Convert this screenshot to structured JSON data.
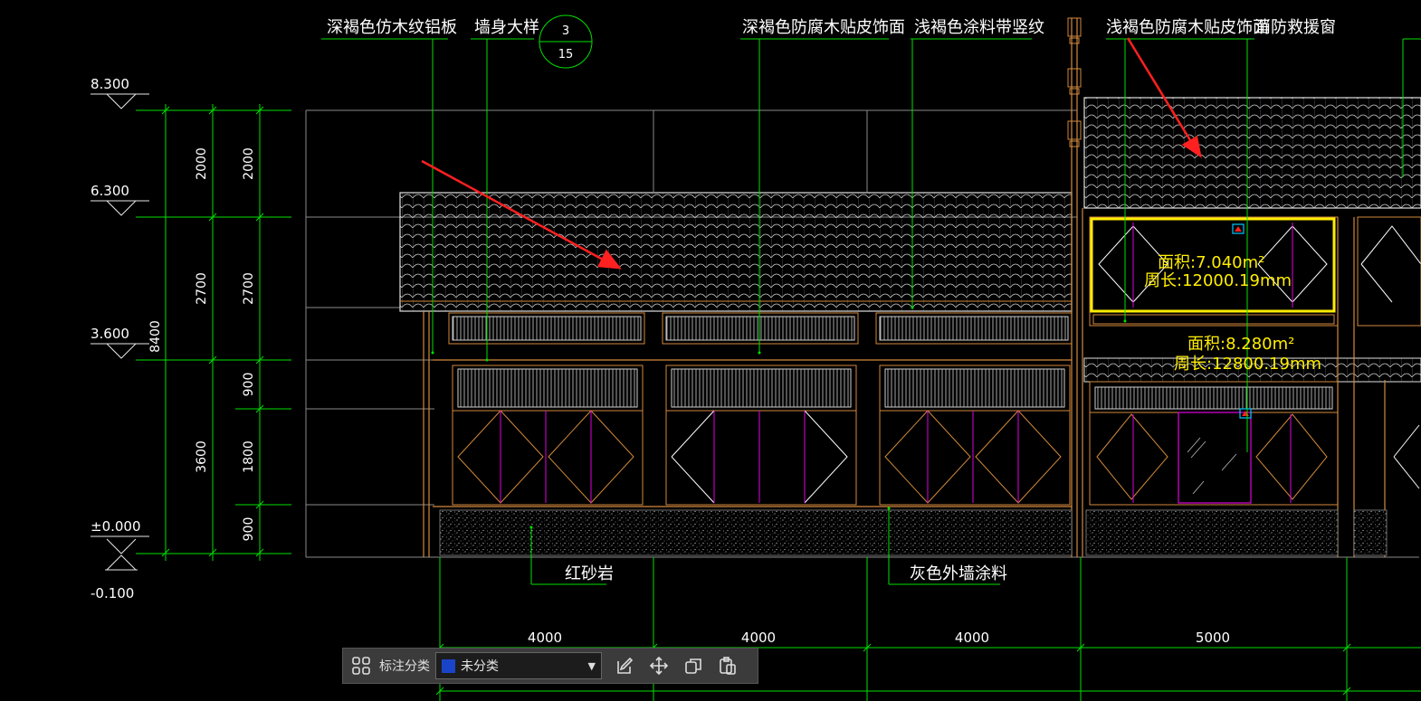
{
  "colors": {
    "background": "#000000",
    "grid": "#00e000",
    "outline": "#d8d8d8",
    "wood": "#d2893c",
    "magenta": "#e000e0",
    "highlight": "#ffee00",
    "arrow": "#ff2020",
    "label": "#ffffff",
    "toolbar_bg": "#3b3b3b",
    "swatch": "#1a44c8"
  },
  "elevations": [
    {
      "label": "8.300"
    },
    {
      "label": "6.300"
    },
    {
      "label": "3.600"
    },
    {
      "label": "±0.000"
    },
    {
      "label": "-0.100"
    }
  ],
  "total_height_label": "8400",
  "dims_col1": [
    "2000",
    "2700",
    "3600"
  ],
  "dims_col2": [
    "2000",
    "2700",
    "900",
    "1800",
    "900"
  ],
  "callouts": {
    "aluminum": "深褐色仿木纹铝板",
    "wall_detail": "墙身大样",
    "detail_top": "3",
    "detail_bottom": "15",
    "dark_wood": "深褐色防腐木贴皮饰面",
    "light_paint": "浅褐色涂料带竖纹",
    "light_wood": "浅褐色防腐木贴皮饰面",
    "fire_window": "消防救援窗",
    "red_sandstone": "红砂岩",
    "grey_paint": "灰色外墙涂料"
  },
  "measurements": {
    "box1_area": "面积:7.040m²",
    "box1_perimeter": "周长:12000.19mm",
    "box2_area": "面积:8.280m²",
    "box2_perimeter": "周长:12800.19mm"
  },
  "bay_dims": [
    "4000",
    "4000",
    "4000",
    "5000"
  ],
  "toolbar": {
    "label": "标注分类",
    "selected": "未分类"
  }
}
